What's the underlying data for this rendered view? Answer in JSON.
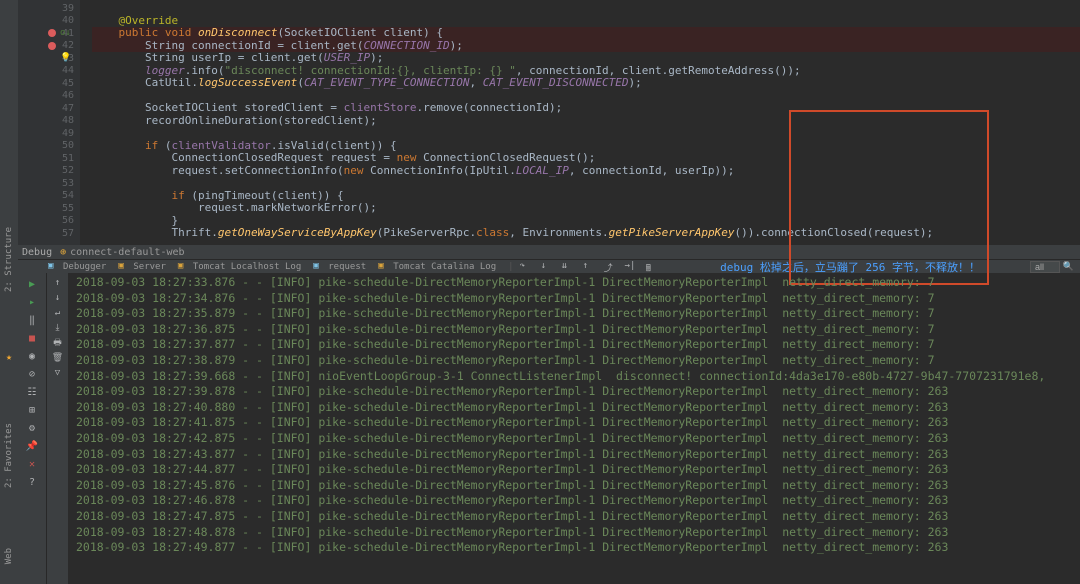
{
  "editor": {
    "lines": [
      {
        "num": 39,
        "html": ""
      },
      {
        "num": 40,
        "html": "    <span class='annotation'>@Override</span>"
      },
      {
        "num": 41,
        "html": "    <span class='kw'>public void</span> <span class='static-method'>onDisconnect</span>(SocketIOClient client) {",
        "breakpoint": true,
        "override": true
      },
      {
        "num": 42,
        "html": "        String connectionId = client.get(<span class='static-field'>CONNECTION_ID</span>);",
        "breakpoint": true
      },
      {
        "num": 43,
        "html": "        String userIp = client.get(<span class='static-field'>USER_IP</span>);",
        "bulb": true
      },
      {
        "num": 44,
        "html": "        <span class='field italic'>logger</span>.info(<span class='string'>\"disconnect! connectionId:{}, clientIp: {} \"</span>, connectionId, client.getRemoteAddress());"
      },
      {
        "num": 45,
        "html": "        CatUtil.<span class='static-method'>logSuccessEvent</span>(<span class='static-field'>CAT_EVENT_TYPE_CONNECTION</span>, <span class='static-field'>CAT_EVENT_DISCONNECTED</span>);"
      },
      {
        "num": 46,
        "html": ""
      },
      {
        "num": 47,
        "html": "        SocketIOClient storedClient = <span class='field'>clientStore</span>.remove(connectionId);"
      },
      {
        "num": 48,
        "html": "        recordOnlineDuration(storedClient);"
      },
      {
        "num": 49,
        "html": ""
      },
      {
        "num": 50,
        "html": "        <span class='kw'>if</span> (<span class='field'>clientValidator</span>.isValid(client)) {"
      },
      {
        "num": 51,
        "html": "            ConnectionClosedRequest request = <span class='kw'>new</span> ConnectionClosedRequest();"
      },
      {
        "num": 52,
        "html": "            request.setConnectionInfo(<span class='kw'>new</span> ConnectionInfo(IpUtil.<span class='static-field'>LOCAL_IP</span>, connectionId, userIp));"
      },
      {
        "num": 53,
        "html": ""
      },
      {
        "num": 54,
        "html": "            <span class='kw'>if</span> (pingTimeout(client)) {"
      },
      {
        "num": 55,
        "html": "                request.markNetworkError();"
      },
      {
        "num": 56,
        "html": "            }"
      },
      {
        "num": 57,
        "html": "            Thrift.<span class='static-method'>getOneWayServiceByAppKey</span>(PikeServerRpc.<span class='kw'>class</span>, Environments.<span class='static-method'>getPikeServerAppKey</span>()).connectionClosed(request);"
      }
    ]
  },
  "debugTab": {
    "label": "Debug",
    "config": "connect-default-web"
  },
  "toolbar": {
    "debugger": "Debugger",
    "server": "Server",
    "tomcatLog": "Tomcat Localhost Log",
    "request": "request",
    "catalinaLog": "Tomcat Catalina Log",
    "search": "all"
  },
  "annotation": "debug 松掉之后，立马蹦了 256 字节，不释放！！",
  "console": {
    "lines": [
      "2018-09-03 18:27:33.876 - - [INFO] pike-schedule-DirectMemoryReporterImpl-1 DirectMemoryReporterImpl  netty_direct_memory: 7",
      "2018-09-03 18:27:34.876 - - [INFO] pike-schedule-DirectMemoryReporterImpl-1 DirectMemoryReporterImpl  netty_direct_memory: 7",
      "2018-09-03 18:27:35.879 - - [INFO] pike-schedule-DirectMemoryReporterImpl-1 DirectMemoryReporterImpl  netty_direct_memory: 7",
      "2018-09-03 18:27:36.875 - - [INFO] pike-schedule-DirectMemoryReporterImpl-1 DirectMemoryReporterImpl  netty_direct_memory: 7",
      "2018-09-03 18:27:37.877 - - [INFO] pike-schedule-DirectMemoryReporterImpl-1 DirectMemoryReporterImpl  netty_direct_memory: 7",
      "2018-09-03 18:27:38.879 - - [INFO] pike-schedule-DirectMemoryReporterImpl-1 DirectMemoryReporterImpl  netty_direct_memory: 7",
      "2018-09-03 18:27:39.668 - - [INFO] nioEventLoopGroup-3-1 ConnectListenerImpl  disconnect! connectionId:4da3e170-e80b-4727-9b47-7707231791e8,",
      "2018-09-03 18:27:39.878 - - [INFO] pike-schedule-DirectMemoryReporterImpl-1 DirectMemoryReporterImpl  netty_direct_memory: 263",
      "2018-09-03 18:27:40.880 - - [INFO] pike-schedule-DirectMemoryReporterImpl-1 DirectMemoryReporterImpl  netty_direct_memory: 263",
      "2018-09-03 18:27:41.875 - - [INFO] pike-schedule-DirectMemoryReporterImpl-1 DirectMemoryReporterImpl  netty_direct_memory: 263",
      "2018-09-03 18:27:42.875 - - [INFO] pike-schedule-DirectMemoryReporterImpl-1 DirectMemoryReporterImpl  netty_direct_memory: 263",
      "2018-09-03 18:27:43.877 - - [INFO] pike-schedule-DirectMemoryReporterImpl-1 DirectMemoryReporterImpl  netty_direct_memory: 263",
      "2018-09-03 18:27:44.877 - - [INFO] pike-schedule-DirectMemoryReporterImpl-1 DirectMemoryReporterImpl  netty_direct_memory: 263",
      "2018-09-03 18:27:45.876 - - [INFO] pike-schedule-DirectMemoryReporterImpl-1 DirectMemoryReporterImpl  netty_direct_memory: 263",
      "2018-09-03 18:27:46.878 - - [INFO] pike-schedule-DirectMemoryReporterImpl-1 DirectMemoryReporterImpl  netty_direct_memory: 263",
      "2018-09-03 18:27:47.875 - - [INFO] pike-schedule-DirectMemoryReporterImpl-1 DirectMemoryReporterImpl  netty_direct_memory: 263",
      "2018-09-03 18:27:48.878 - - [INFO] pike-schedule-DirectMemoryReporterImpl-1 DirectMemoryReporterImpl  netty_direct_memory: 263",
      "2018-09-03 18:27:49.877 - - [INFO] pike-schedule-DirectMemoryReporterImpl-1 DirectMemoryReporterImpl  netty_direct_memory: 263"
    ]
  },
  "sideTabs": {
    "structure": "2: Structure",
    "favorites": "2: Favorites",
    "web": "Web"
  }
}
